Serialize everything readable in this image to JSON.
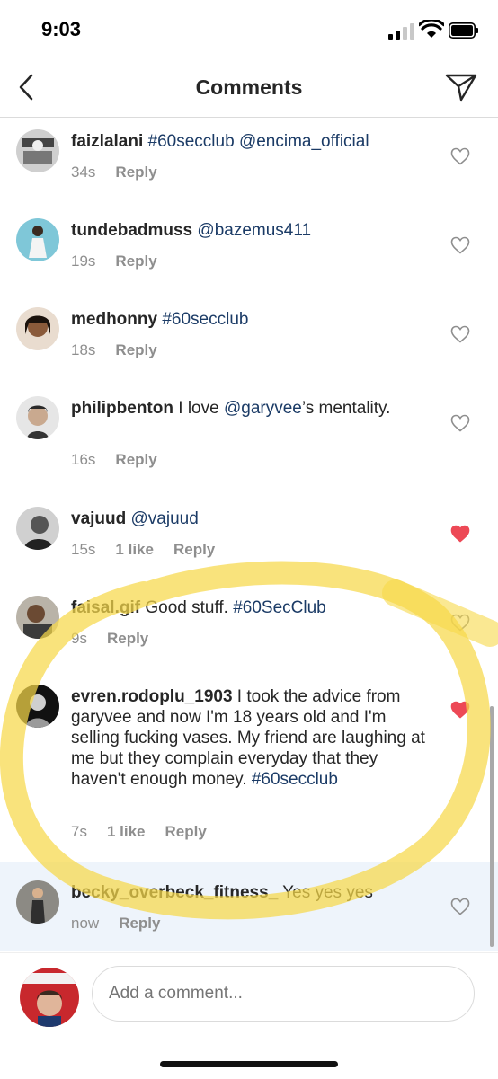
{
  "status_bar": {
    "time": "9:03"
  },
  "nav": {
    "title": "Comments",
    "back_icon": "chevron-left-icon",
    "send_icon": "paper-plane-icon"
  },
  "comments": [
    {
      "username": "faizlalani",
      "parts": [
        " ",
        "#60secclub",
        " ",
        "@encima_official"
      ],
      "time": "34s",
      "likes": "",
      "reply": "Reply",
      "liked": false
    },
    {
      "username": "tundebadmuss",
      "parts": [
        " ",
        "@bazemus411"
      ],
      "time": "19s",
      "likes": "",
      "reply": "Reply",
      "liked": false
    },
    {
      "username": "medhonny",
      "parts": [
        " ",
        "#60secclub"
      ],
      "time": "18s",
      "likes": "",
      "reply": "Reply",
      "liked": false
    },
    {
      "username": "philipbenton",
      "text": " I love ",
      "mention": "@garyvee",
      "text2": "’s mentality.",
      "time": "16s",
      "reply": "Reply",
      "liked": false
    },
    {
      "username": "vajuud",
      "parts": [
        " ",
        "@vajuud"
      ],
      "time": "15s",
      "likes": "1 like",
      "reply": "Reply",
      "liked": true
    },
    {
      "username": "faisal.gif",
      "text": " Good stuff. ",
      "tag": "#60SecClub",
      "time": "9s",
      "reply": "Reply",
      "liked": false
    },
    {
      "username": "evren.rodoplu_1903",
      "text": " I took the advice from garyvee and now I'm 18 years old and I'm selling fucking vases. My friend are laughing at me but they complain everyday that they haven't enough money. ",
      "tag": "#60secclub",
      "time": "7s",
      "likes": "1 like",
      "reply": "Reply",
      "liked": true
    },
    {
      "username": "becky_overbeck_fitness_",
      "text": " Yes yes yes",
      "time": "now",
      "reply": "Reply",
      "liked": false
    }
  ],
  "composer": {
    "placeholder": "Add a comment..."
  },
  "colors": {
    "link": "#1b3b66",
    "heart_liked": "#ed4956",
    "marker": "#f7d84a"
  }
}
